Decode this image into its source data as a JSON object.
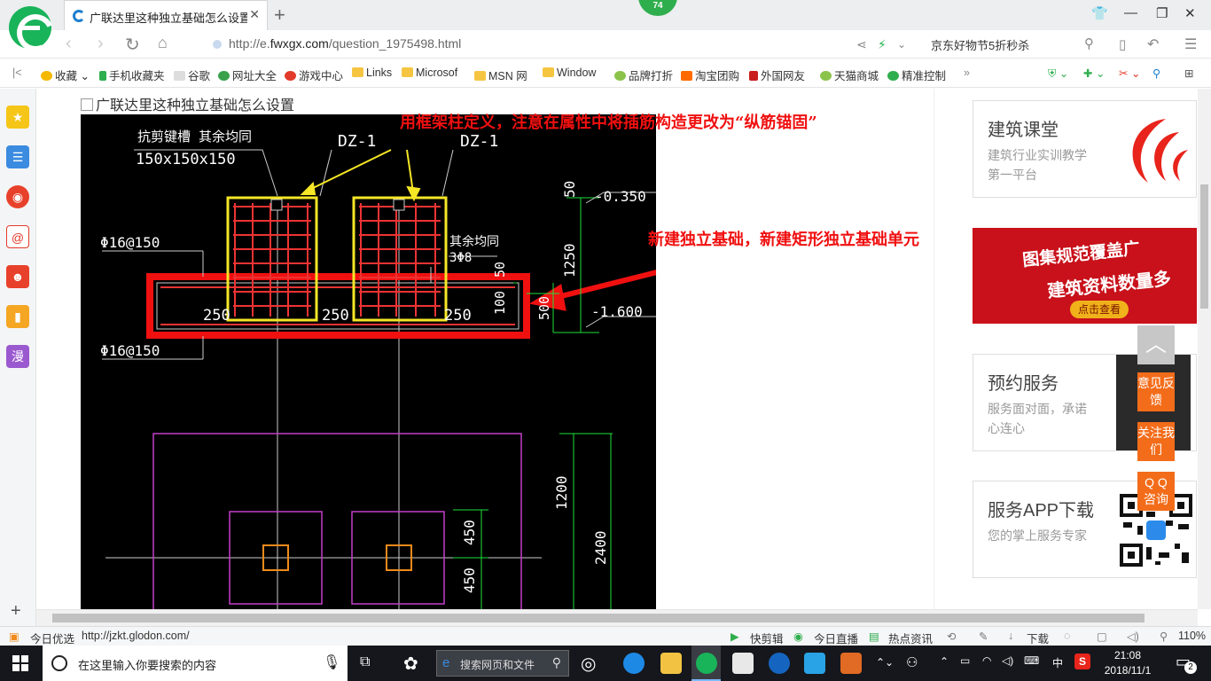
{
  "tab": {
    "title": "广联达里这种独立基础怎么设置",
    "close": "✕",
    "new_tab": "+"
  },
  "notification_count": "74",
  "window": {
    "minimize": "—",
    "restore": "❐",
    "close": "✕"
  },
  "address": {
    "url_prefix": "http://e.",
    "url_domain": "fwxgx.com",
    "url_path": "/question_1975498.html"
  },
  "search_box": {
    "value": "京东好物节5折秒杀"
  },
  "bookmarks": [
    {
      "label": "收藏"
    },
    {
      "label": "手机收藏夹"
    },
    {
      "label": "谷歌"
    },
    {
      "label": "网址大全"
    },
    {
      "label": "游戏中心"
    },
    {
      "label": "Links"
    },
    {
      "label": "Microsof"
    },
    {
      "label": "MSN 网"
    },
    {
      "label": "Window"
    },
    {
      "label": "品牌打折"
    },
    {
      "label": "淘宝团购"
    },
    {
      "label": "外国网友"
    },
    {
      "label": "天猫商城"
    },
    {
      "label": "精准控制"
    },
    {
      "label": "»"
    }
  ],
  "sidebar": {
    "plus": "+",
    "comic": "漫"
  },
  "page": {
    "broken_image_alt": "广联达里这种独立基础怎么设置",
    "annotation_top": "用框架柱定义，注意在属性中将插筋构造更改为“纵筋锚固”",
    "annotation_right": "新建独立基础，新建矩形独立基础单元"
  },
  "cad": {
    "note_shear": "抗剪键槽 其余均同",
    "size_shear": "150x150x150",
    "dz1_left": "DZ-1",
    "dz1_right": "DZ-1",
    "rebar_top": "Φ16@150",
    "rebar_bottom": "Φ16@150",
    "note_rest": "其余均同",
    "rebar_3": "3Φ8",
    "dim_250a": "250",
    "dim_250b": "250",
    "dim_250c": "250",
    "dim_50a": "50",
    "dim_50b": "50",
    "dim_100": "100",
    "dim_500": "500",
    "dim_1250": "1250",
    "elev_top": "-0.350",
    "elev_bot": "-1.600",
    "dim_1200": "1200",
    "dim_2400": "2400",
    "dim_450a": "450",
    "dim_450b": "450"
  },
  "right_panel": {
    "card1": {
      "title": "建筑课堂",
      "desc": "建筑行业实训教学第一平台"
    },
    "promo": {
      "line1": "图集规范覆盖广",
      "line2": "建筑资料数量多",
      "button": "点击查看"
    },
    "card2": {
      "title": "预约服务",
      "desc": "服务面对面，承诺心连心"
    },
    "card3": {
      "title": "服务APP下载",
      "desc": "您的掌上服务专家"
    },
    "float_feedback": "意见反馈",
    "float_follow": "关注我们",
    "float_qq": "Q Q 咨询"
  },
  "statusbar": {
    "today": "今日优选",
    "url": "http://jzkt.glodon.com/",
    "clip": "快剪辑",
    "live": "今日直播",
    "news": "热点资讯",
    "download": "下载",
    "zoom": "110%"
  },
  "taskbar": {
    "search_placeholder": "在这里输入你要搜索的内容",
    "web_search": "搜索网页和文件",
    "ime": "中",
    "time": "21:08",
    "date": "2018/11/1",
    "notif_count": "2"
  }
}
